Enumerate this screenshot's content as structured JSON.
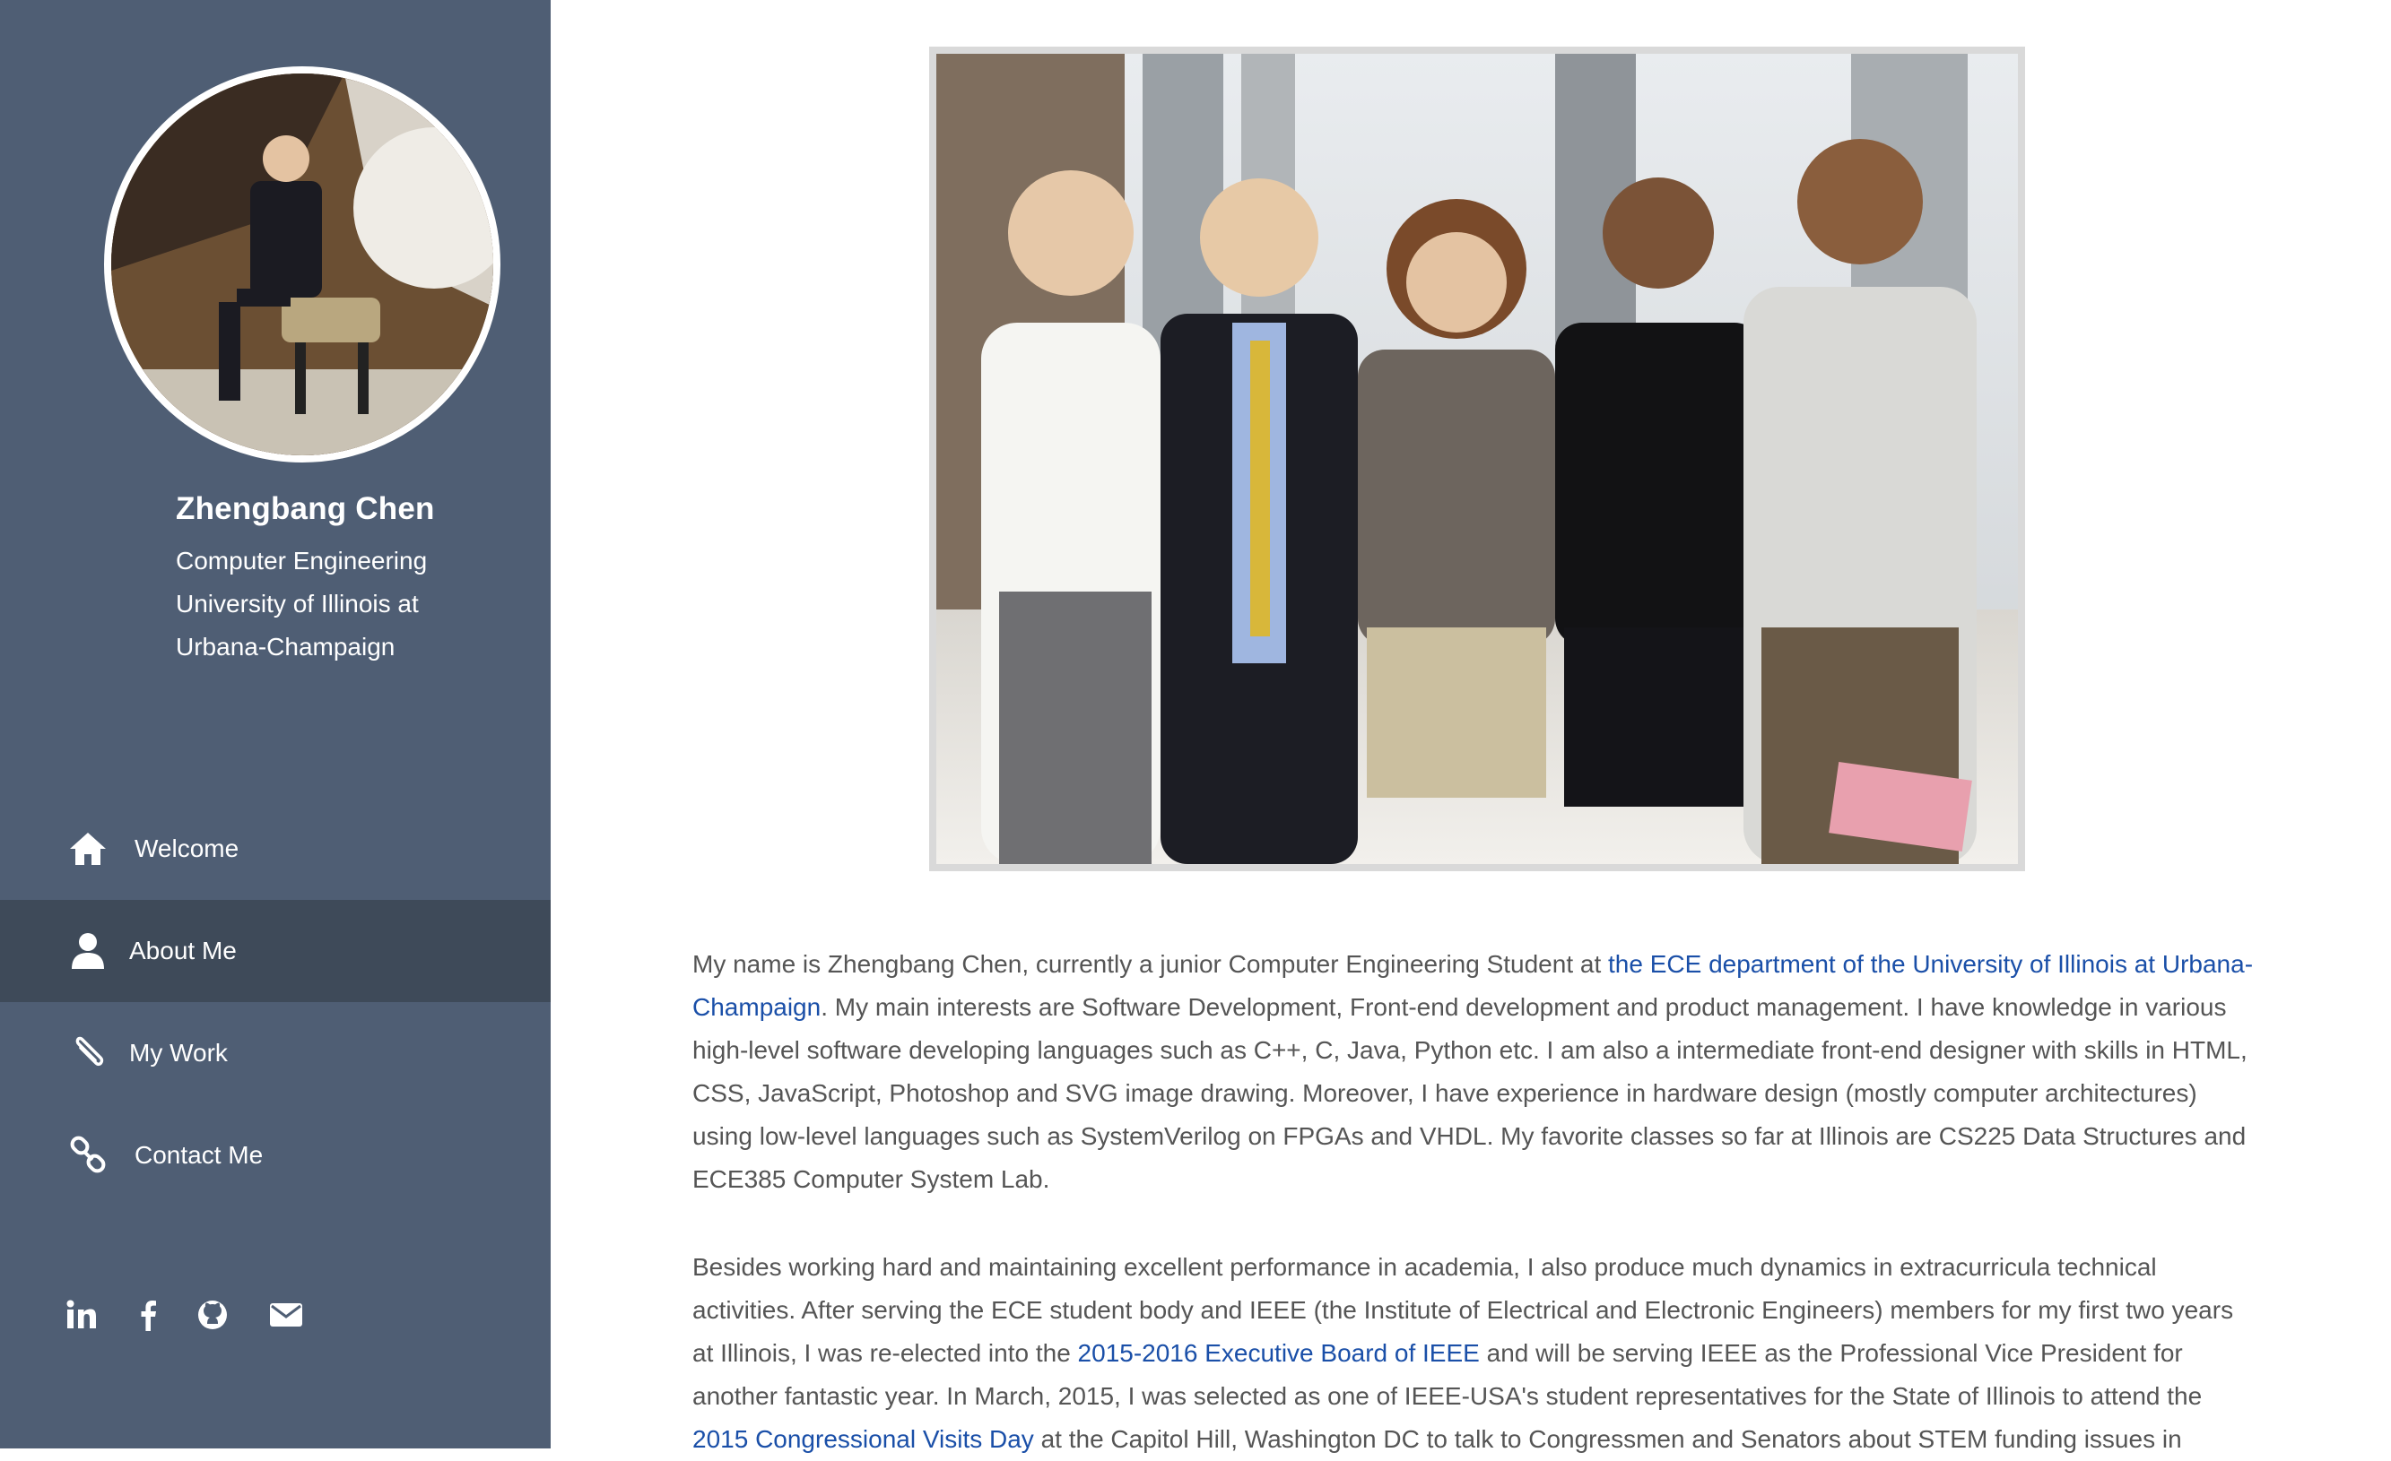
{
  "profile": {
    "name": "Zhengbang Chen",
    "line1": "Computer Engineering",
    "line2": "University of Illinois at",
    "line3": "Urbana-Champaign"
  },
  "nav": {
    "items": [
      {
        "label": "Welcome",
        "icon": "home-icon",
        "active": false
      },
      {
        "label": "About Me",
        "icon": "user-icon",
        "active": true
      },
      {
        "label": "My Work",
        "icon": "paperclip-icon",
        "active": false
      },
      {
        "label": "Contact Me",
        "icon": "link-icon",
        "active": false
      }
    ]
  },
  "social": {
    "items": [
      "linkedin-icon",
      "facebook-icon",
      "github-icon",
      "email-icon"
    ]
  },
  "about": {
    "p1_a": "My name is Zhengbang Chen, currently a junior Computer Engineering Student at ",
    "p1_link": "the ECE department of the University of Illinois at Urbana-Champaign",
    "p1_b": ". My main interests are Software Development, Front-end development and product management. I have knowledge in various high-level software developing languages such as C++, C, Java, Python etc. I am also a intermediate front-end designer with skills in HTML, CSS, JavaScript, Photoshop and SVG image drawing. Moreover, I have experience in hardware design (mostly computer architectures) using low-level languages such as SystemVerilog on FPGAs and VHDL. My favorite classes so far at Illinois are CS225 Data Structures and ECE385 Computer System Lab.",
    "p2_a": "Besides working hard and maintaining excellent performance in academia, I also produce much dynamics in extracurricula technical activities. After serving the ECE student body and IEEE (the Institute of Electrical and Electronic Engineers) members for my first two years at Illinois, I was re-elected into the ",
    "p2_link1": "2015-2016 Executive Board of IEEE",
    "p2_b": " and will be serving IEEE as the Professional Vice President for another fantastic year. In March, 2015, I was selected as one of IEEE-USA's student representatives for the State of Illinois to attend the ",
    "p2_link2": "2015 Congressional Visits Day",
    "p2_c": " at the Capitol Hill, Washington DC to talk to Congressmen and Senators about STEM funding issues in"
  },
  "colors": {
    "sidebar_bg": "#4f5e74",
    "sidebar_active": "#3e4a59",
    "link": "#1a4fa8",
    "body_text": "#555555"
  }
}
